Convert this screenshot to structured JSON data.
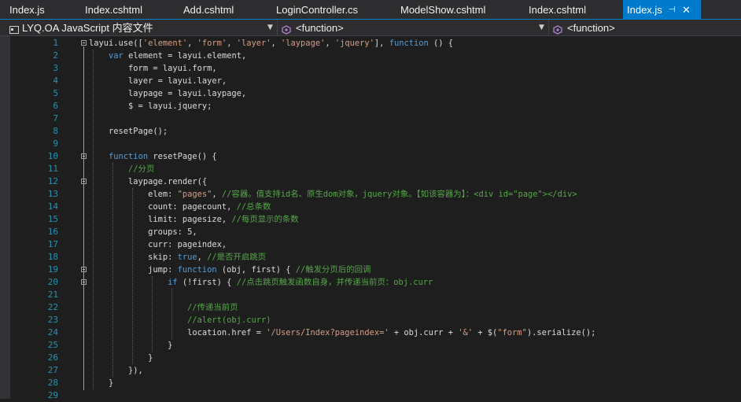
{
  "tabs": [
    {
      "label": "Index.js",
      "active": false
    },
    {
      "label": "Index.cshtml",
      "active": false
    },
    {
      "label": "Add.cshtml",
      "active": false
    },
    {
      "label": "LoginController.cs",
      "active": false
    },
    {
      "label": "ModelShow.cshtml",
      "active": false
    },
    {
      "label": "Index.cshtml",
      "active": false
    },
    {
      "label": "Index.js",
      "active": true
    }
  ],
  "nav": {
    "project": "LYQ.OA JavaScript 内容文件",
    "scope": "<function>",
    "member": "<function>"
  },
  "colors": {
    "accent": "#007acc",
    "keyword": "#569cd6",
    "string": "#d69d85",
    "comment": "#57a64a",
    "line_number": "#2b91af"
  },
  "lines": [
    {
      "n": "1",
      "fold": true,
      "parts": [
        {
          "t": "layui.use(["
        },
        {
          "t": "'element'",
          "c": "str"
        },
        {
          "t": ", "
        },
        {
          "t": "'form'",
          "c": "str"
        },
        {
          "t": ", "
        },
        {
          "t": "'layer'",
          "c": "str"
        },
        {
          "t": ", "
        },
        {
          "t": "'laypage'",
          "c": "str"
        },
        {
          "t": ", "
        },
        {
          "t": "'jquery'",
          "c": "str"
        },
        {
          "t": "], "
        },
        {
          "t": "function",
          "c": "kw"
        },
        {
          "t": " () {"
        }
      ]
    },
    {
      "n": "2",
      "parts": [
        {
          "t": "    "
        },
        {
          "t": "var",
          "c": "kw"
        },
        {
          "t": " element = layui.element,"
        }
      ]
    },
    {
      "n": "3",
      "parts": [
        {
          "t": "        form = layui.form,"
        }
      ]
    },
    {
      "n": "4",
      "parts": [
        {
          "t": "        layer = layui.layer,"
        }
      ]
    },
    {
      "n": "5",
      "parts": [
        {
          "t": "        laypage = layui.laypage,"
        }
      ]
    },
    {
      "n": "6",
      "parts": [
        {
          "t": "        $ = layui.jquery;"
        }
      ]
    },
    {
      "n": "7",
      "parts": [
        {
          "t": ""
        }
      ]
    },
    {
      "n": "8",
      "parts": [
        {
          "t": "    resetPage();"
        }
      ]
    },
    {
      "n": "9",
      "parts": [
        {
          "t": ""
        }
      ]
    },
    {
      "n": "10",
      "fold": true,
      "parts": [
        {
          "t": "    "
        },
        {
          "t": "function",
          "c": "kw"
        },
        {
          "t": " resetPage() {"
        }
      ]
    },
    {
      "n": "11",
      "parts": [
        {
          "t": "        "
        },
        {
          "t": "//分页",
          "c": "cm"
        }
      ]
    },
    {
      "n": "12",
      "fold": true,
      "parts": [
        {
          "t": "        laypage.render({"
        }
      ]
    },
    {
      "n": "13",
      "parts": [
        {
          "t": "            elem: "
        },
        {
          "t": "\"pages\"",
          "c": "str"
        },
        {
          "t": ", "
        },
        {
          "t": "//容器。值支持id名、原生dom对象，jquery对象。【如该容器为】：<div id=\"page\"></div>",
          "c": "cm"
        }
      ]
    },
    {
      "n": "14",
      "parts": [
        {
          "t": "            count: pagecount, "
        },
        {
          "t": "//总条数",
          "c": "cm"
        }
      ]
    },
    {
      "n": "15",
      "parts": [
        {
          "t": "            limit: pagesize, "
        },
        {
          "t": "//每页显示的条数",
          "c": "cm"
        }
      ]
    },
    {
      "n": "16",
      "parts": [
        {
          "t": "            groups: 5,"
        }
      ]
    },
    {
      "n": "17",
      "parts": [
        {
          "t": "            curr: pageindex,"
        }
      ]
    },
    {
      "n": "18",
      "parts": [
        {
          "t": "            skip: "
        },
        {
          "t": "true",
          "c": "kw"
        },
        {
          "t": ", "
        },
        {
          "t": "//是否开启跳页",
          "c": "cm"
        }
      ]
    },
    {
      "n": "19",
      "fold": true,
      "parts": [
        {
          "t": "            jump: "
        },
        {
          "t": "function",
          "c": "kw"
        },
        {
          "t": " (obj, first) { "
        },
        {
          "t": "//触发分页后的回调",
          "c": "cm"
        }
      ]
    },
    {
      "n": "20",
      "fold": true,
      "parts": [
        {
          "t": "                "
        },
        {
          "t": "if",
          "c": "kw"
        },
        {
          "t": " (!first) { "
        },
        {
          "t": "//点击跳页触发函数自身，并传递当前页：obj.curr",
          "c": "cm"
        }
      ]
    },
    {
      "n": "21",
      "parts": [
        {
          "t": ""
        }
      ]
    },
    {
      "n": "22",
      "parts": [
        {
          "t": "                    "
        },
        {
          "t": "//传递当前页",
          "c": "cm"
        }
      ]
    },
    {
      "n": "23",
      "parts": [
        {
          "t": "                    "
        },
        {
          "t": "//alert(obj.curr)",
          "c": "cm"
        }
      ]
    },
    {
      "n": "24",
      "parts": [
        {
          "t": "                    location.href = "
        },
        {
          "t": "'/Users/Index?pageindex='",
          "c": "str"
        },
        {
          "t": " + obj.curr + "
        },
        {
          "t": "'&'",
          "c": "str"
        },
        {
          "t": " + $("
        },
        {
          "t": "\"form\"",
          "c": "str"
        },
        {
          "t": ").serialize();"
        }
      ]
    },
    {
      "n": "25",
      "parts": [
        {
          "t": "                }"
        }
      ]
    },
    {
      "n": "26",
      "parts": [
        {
          "t": "            }"
        }
      ]
    },
    {
      "n": "27",
      "parts": [
        {
          "t": "        }),"
        }
      ]
    },
    {
      "n": "28",
      "parts": [
        {
          "t": "    }"
        }
      ]
    },
    {
      "n": "29",
      "parts": [
        {
          "t": ""
        }
      ]
    }
  ]
}
